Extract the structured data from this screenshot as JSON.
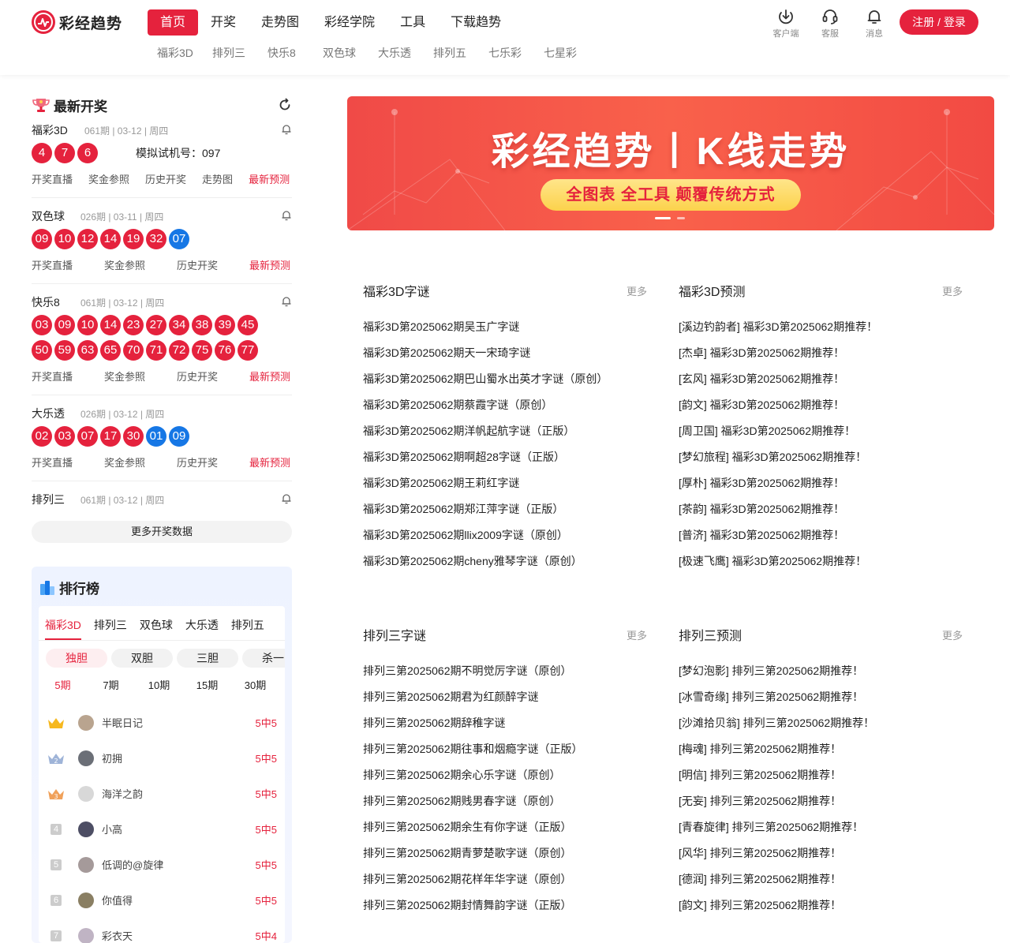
{
  "header": {
    "logo_text": "彩经趋势",
    "nav": [
      "首页",
      "开奖",
      "走势图",
      "彩经学院",
      "工具",
      "下载趋势"
    ],
    "subnav": [
      "福彩3D",
      "排列三",
      "快乐8",
      "双色球",
      "大乐透",
      "排列五",
      "七乐彩",
      "七星彩"
    ],
    "icons": [
      {
        "label": "客户端",
        "icon": "download-icon"
      },
      {
        "label": "客服",
        "icon": "headset-icon"
      },
      {
        "label": "消息",
        "icon": "bell-icon"
      }
    ],
    "login": "注册 / 登录"
  },
  "latest": {
    "title": "最新开奖",
    "lotteries": [
      {
        "name": "福彩3D",
        "meta": "061期 | 03-12 |  周四",
        "red": [
          "4",
          "7",
          "6"
        ],
        "blue": [],
        "sim": "模拟试机号：097",
        "links": [
          "开奖直播",
          "奖金参照",
          "历史开奖",
          "走势图",
          "最新预测"
        ]
      },
      {
        "name": "双色球",
        "meta": "026期 | 03-11 |  周四",
        "red": [
          "09",
          "10",
          "12",
          "14",
          "19",
          "32"
        ],
        "blue": [
          "07"
        ],
        "links": [
          "开奖直播",
          "奖金参照",
          "历史开奖",
          "最新预测"
        ]
      },
      {
        "name": "快乐8",
        "meta": "061期 | 03-12 |  周四",
        "red": [
          "03",
          "09",
          "10",
          "14",
          "23",
          "27",
          "34",
          "38",
          "39",
          "45",
          "50",
          "59",
          "63",
          "65",
          "70",
          "71",
          "72",
          "75",
          "76",
          "77"
        ],
        "blue": [],
        "links": [
          "开奖直播",
          "奖金参照",
          "历史开奖",
          "最新预测"
        ]
      },
      {
        "name": "大乐透",
        "meta": "026期 | 03-12 |  周四",
        "red": [
          "02",
          "03",
          "07",
          "17",
          "30"
        ],
        "blue": [
          "01",
          "09"
        ],
        "links": [
          "开奖直播",
          "奖金参照",
          "历史开奖",
          "最新预测"
        ]
      },
      {
        "name": "排列三",
        "meta": "061期 | 03-12 |  周四",
        "red": [],
        "blue": [],
        "links": []
      }
    ],
    "more": "更多开奖数据"
  },
  "rank": {
    "title": "排行榜",
    "tabs": [
      "福彩3D",
      "排列三",
      "双色球",
      "大乐透",
      "排列五"
    ],
    "pills": [
      "独胆",
      "双胆",
      "三胆",
      "杀一"
    ],
    "periods": [
      "5期",
      "7期",
      "10期",
      "15期",
      "30期"
    ],
    "rows": [
      {
        "rank": "1",
        "user": "半眠日记",
        "score": "5中5"
      },
      {
        "rank": "2",
        "user": "初拥",
        "score": "5中5"
      },
      {
        "rank": "3",
        "user": "海洋之韵",
        "score": "5中5"
      },
      {
        "rank": "4",
        "user": "小高",
        "score": "5中5"
      },
      {
        "rank": "5",
        "user": "低调的@旋律",
        "score": "5中5"
      },
      {
        "rank": "6",
        "user": "你值得",
        "score": "5中5"
      },
      {
        "rank": "7",
        "user": "彩衣天",
        "score": "5中4"
      }
    ]
  },
  "banner": {
    "title": "彩经趋势丨K线走势",
    "subtitle": "全图表 全工具 颠覆传统方式"
  },
  "columns": [
    {
      "title": "福彩3D字谜",
      "more": "更多",
      "items": [
        "福彩3D第2025062期吴玉广字谜",
        "福彩3D第2025062期天一宋琦字谜",
        "福彩3D第2025062期巴山蜀水出英才字谜（原创）",
        "福彩3D第2025062期蔡霞字谜（原创）",
        "福彩3D第2025062期洋帆起航字谜（正版）",
        "福彩3D第2025062期啊超28字谜（正版）",
        "福彩3D第2025062期王莉红字谜",
        "福彩3D第2025062期郑江萍字谜（正版）",
        "福彩3D第2025062期llix2009字谜（原创）",
        "福彩3D第2025062期cheny雅琴字谜（原创）"
      ]
    },
    {
      "title": "福彩3D预测",
      "more": "更多",
      "items": [
        "[溪边钓韵者] 福彩3D第2025062期推荐！",
        "[杰卓] 福彩3D第2025062期推荐！",
        "[玄风] 福彩3D第2025062期推荐！",
        "[韵文] 福彩3D第2025062期推荐！",
        "[周卫国] 福彩3D第2025062期推荐！",
        "[梦幻旅程] 福彩3D第2025062期推荐！",
        "[厚朴] 福彩3D第2025062期推荐！",
        "[茶韵] 福彩3D第2025062期推荐！",
        "[普济] 福彩3D第2025062期推荐！",
        "[极速飞鹰] 福彩3D第2025062期推荐！"
      ]
    },
    {
      "title": "排列三字谜",
      "more": "更多",
      "items": [
        "排列三第2025062期不明觉厉字谜（原创）",
        "排列三第2025062期君为红颜醉字谜",
        "排列三第2025062期辞稚字谜",
        "排列三第2025062期往事和烟瘾字谜（正版）",
        "排列三第2025062期余心乐字谜（原创）",
        "排列三第2025062期贱男春字谜（原创）",
        "排列三第2025062期余生有你字谜（正版）",
        "排列三第2025062期青萝楚歌字谜（原创）",
        "排列三第2025062期花样年华字谜（原创）",
        "排列三第2025062期封情舞韵字谜（正版）"
      ]
    },
    {
      "title": "排列三预测",
      "more": "更多",
      "items": [
        "[梦幻泡影] 排列三第2025062期推荐！",
        "[冰雪奇缘] 排列三第2025062期推荐！",
        "[沙滩拾贝翁] 排列三第2025062期推荐！",
        "[梅魂] 排列三第2025062期推荐！",
        "[明信] 排列三第2025062期推荐！",
        "[无妄] 排列三第2025062期推荐！",
        "[青春旋律] 排列三第2025062期推荐！",
        "[风华] 排列三第2025062期推荐！",
        "[德润] 排列三第2025062期推荐！",
        "[韵文] 排列三第2025062期推荐！"
      ]
    }
  ]
}
